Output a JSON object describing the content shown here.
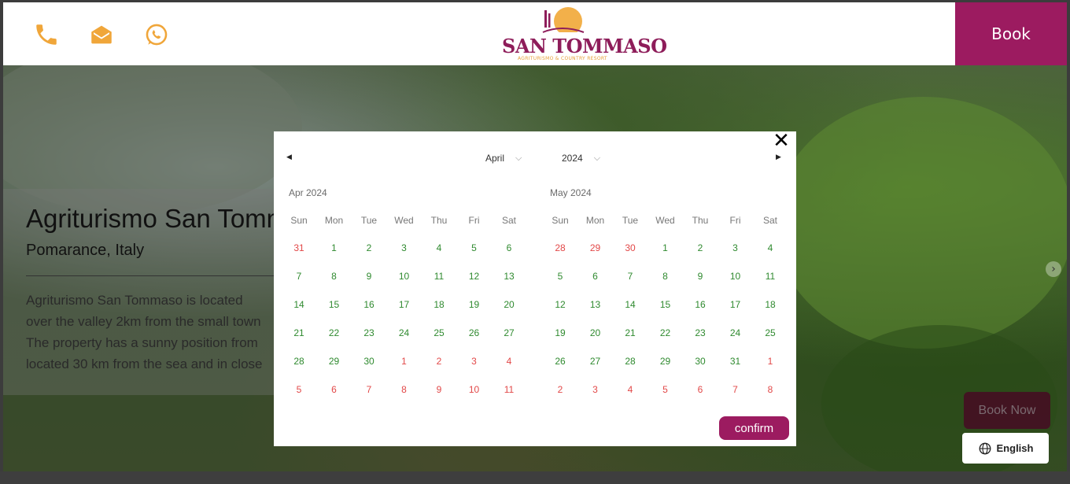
{
  "header": {
    "book_label": "Book",
    "icons": [
      "phone-icon",
      "mail-icon",
      "whatsapp-icon"
    ],
    "logo": {
      "title": "SAN TOMMASO",
      "subtitle": "AGRITURISMO & COUNTRY RESORT"
    }
  },
  "hero": {
    "title": "Agriturismo San Tommaso",
    "subtitle": "Pomarance, Italy",
    "description": [
      "Agriturismo San Tommaso is located",
      "over the valley 2km from the small town",
      "The property has a sunny position from",
      "located 30 km from the sea and in close"
    ],
    "book_now_label": "Book Now",
    "language_label": "English"
  },
  "datepicker": {
    "month_select": "April",
    "year_select": "2024",
    "confirm_label": "confirm",
    "weekdays": [
      "Sun",
      "Mon",
      "Tue",
      "Wed",
      "Thu",
      "Fri",
      "Sat"
    ],
    "months": [
      {
        "title": "Apr 2024",
        "weeks": [
          [
            [
              31,
              0
            ],
            [
              1,
              1
            ],
            [
              2,
              1
            ],
            [
              3,
              1
            ],
            [
              4,
              1
            ],
            [
              5,
              1
            ],
            [
              6,
              1
            ]
          ],
          [
            [
              7,
              1
            ],
            [
              8,
              1
            ],
            [
              9,
              1
            ],
            [
              10,
              1
            ],
            [
              11,
              1
            ],
            [
              12,
              1
            ],
            [
              13,
              1
            ]
          ],
          [
            [
              14,
              1
            ],
            [
              15,
              1
            ],
            [
              16,
              1
            ],
            [
              17,
              1
            ],
            [
              18,
              1
            ],
            [
              19,
              1
            ],
            [
              20,
              1
            ]
          ],
          [
            [
              21,
              1
            ],
            [
              22,
              1
            ],
            [
              23,
              1
            ],
            [
              24,
              1
            ],
            [
              25,
              1
            ],
            [
              26,
              1
            ],
            [
              27,
              1
            ]
          ],
          [
            [
              28,
              1
            ],
            [
              29,
              1
            ],
            [
              30,
              1
            ],
            [
              1,
              0
            ],
            [
              2,
              0
            ],
            [
              3,
              0
            ],
            [
              4,
              0
            ]
          ],
          [
            [
              5,
              0
            ],
            [
              6,
              0
            ],
            [
              7,
              0
            ],
            [
              8,
              0
            ],
            [
              9,
              0
            ],
            [
              10,
              0
            ],
            [
              11,
              0
            ]
          ]
        ]
      },
      {
        "title": "May 2024",
        "weeks": [
          [
            [
              28,
              0
            ],
            [
              29,
              0
            ],
            [
              30,
              0
            ],
            [
              1,
              1
            ],
            [
              2,
              1
            ],
            [
              3,
              1
            ],
            [
              4,
              1
            ]
          ],
          [
            [
              5,
              1
            ],
            [
              6,
              1
            ],
            [
              7,
              1
            ],
            [
              8,
              1
            ],
            [
              9,
              1
            ],
            [
              10,
              1
            ],
            [
              11,
              1
            ]
          ],
          [
            [
              12,
              1
            ],
            [
              13,
              1
            ],
            [
              14,
              1
            ],
            [
              15,
              1
            ],
            [
              16,
              1
            ],
            [
              17,
              1
            ],
            [
              18,
              1
            ]
          ],
          [
            [
              19,
              1
            ],
            [
              20,
              1
            ],
            [
              21,
              1
            ],
            [
              22,
              1
            ],
            [
              23,
              1
            ],
            [
              24,
              1
            ],
            [
              25,
              1
            ]
          ],
          [
            [
              26,
              1
            ],
            [
              27,
              1
            ],
            [
              28,
              1
            ],
            [
              29,
              1
            ],
            [
              30,
              1
            ],
            [
              31,
              1
            ],
            [
              1,
              0
            ]
          ],
          [
            [
              2,
              0
            ],
            [
              3,
              0
            ],
            [
              4,
              0
            ],
            [
              5,
              0
            ],
            [
              6,
              0
            ],
            [
              7,
              0
            ],
            [
              8,
              0
            ]
          ]
        ]
      }
    ]
  },
  "colors": {
    "brand": "#9c1b60",
    "accent": "#f0a63a",
    "in_month": "#2f8a2f",
    "out_month": "#e24848"
  }
}
